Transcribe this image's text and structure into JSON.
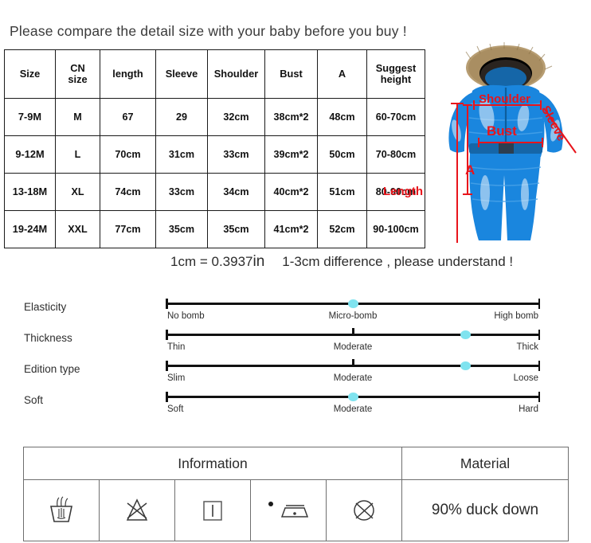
{
  "headline": "Please compare the detail size with your baby before you buy !",
  "size_table": {
    "headers": [
      "Size",
      "CN size",
      "length",
      "Sleeve",
      "Shoulder",
      "Bust",
      "A",
      "Suggest height"
    ],
    "headers_display": {
      "cn_line1": "CN",
      "cn_line2": "size",
      "height_line1": "Suggest",
      "height_line2": "height"
    },
    "rows": [
      {
        "size": "7-9M",
        "cn": "M",
        "length": "67",
        "sleeve": "29",
        "shoulder": "32cm",
        "bust": "38cm*2",
        "a": "48cm",
        "height": "60-70cm"
      },
      {
        "size": "9-12M",
        "cn": "L",
        "length": "70cm",
        "sleeve": "31cm",
        "shoulder": "33cm",
        "bust": "39cm*2",
        "a": "50cm",
        "height": "70-80cm"
      },
      {
        "size": "13-18M",
        "cn": "XL",
        "length": "74cm",
        "sleeve": "33cm",
        "shoulder": "34cm",
        "bust": "40cm*2",
        "a": "51cm",
        "height": "80-90cm"
      },
      {
        "size": "19-24M",
        "cn": "XXL",
        "length": "77cm",
        "sleeve": "35cm",
        "shoulder": "35cm",
        "bust": "41cm*2",
        "a": "52cm",
        "height": "90-100cm"
      }
    ]
  },
  "product_photo": {
    "description": "blue baby snowsuit with fur-trimmed hood",
    "annotation_color": "#e8141b",
    "suit_color": "#1a86de",
    "fur_color": "#b79d72",
    "annotations": {
      "shoulder": "Shoulder",
      "sleeve": "Sleeve",
      "bust": "Bust",
      "a": "A",
      "length": "Length"
    }
  },
  "conversion": {
    "formula": "1cm = 0.3937",
    "unit": "in",
    "note": "1-3cm difference , please understand !"
  },
  "sliders": {
    "marker_color": "#7fe3ef",
    "rows": [
      {
        "name": "Elasticity",
        "labels": {
          "start": "No bomb",
          "middle": "Micro-bomb",
          "end": "High bomb"
        },
        "value_percent": 50,
        "selected": "Micro-bomb"
      },
      {
        "name": "Thickness",
        "labels": {
          "start": "Thin",
          "middle": "Moderate",
          "end": "Thick"
        },
        "value_percent": 80,
        "selected": "Thick"
      },
      {
        "name": "Edition type",
        "labels": {
          "start": "Slim",
          "middle": "Moderate",
          "end": "Loose"
        },
        "value_percent": 80,
        "selected": "Loose"
      },
      {
        "name": "Soft",
        "labels": {
          "start": "Soft",
          "middle": "Moderate",
          "end": "Hard"
        },
        "value_percent": 50,
        "selected": "Moderate"
      }
    ]
  },
  "care_table": {
    "information_header": "Information",
    "material_header": "Material",
    "material_value": "90% duck down",
    "icons": [
      {
        "name": "hand-wash-icon",
        "meaning": "hand wash"
      },
      {
        "name": "do-not-bleach-icon",
        "meaning": "do not bleach"
      },
      {
        "name": "drip-dry-icon",
        "meaning": "drip dry"
      },
      {
        "name": "iron-low-heat-icon",
        "meaning": "iron low heat"
      },
      {
        "name": "do-not-dry-clean-icon",
        "meaning": "do not dry clean"
      }
    ]
  }
}
